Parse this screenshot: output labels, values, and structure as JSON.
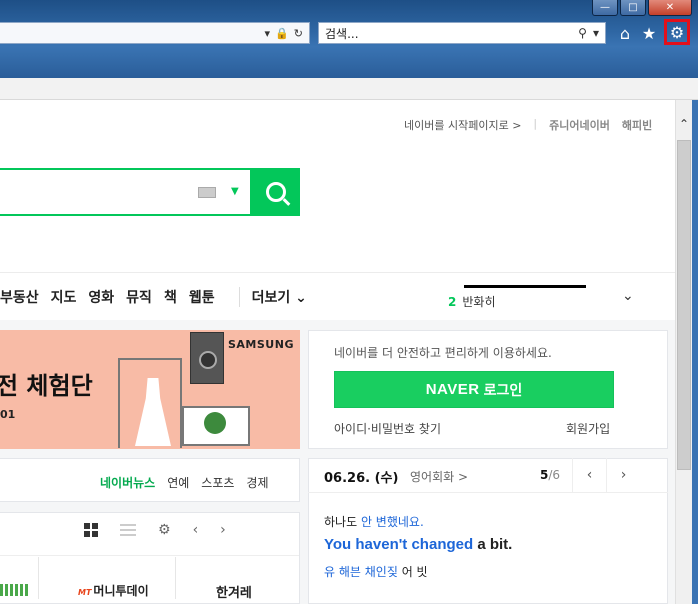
{
  "browser": {
    "search_placeholder": "검색...",
    "window_controls": {
      "minimize": "—",
      "maximize": "□",
      "close": "✕"
    },
    "icons": {
      "home": "home-icon",
      "favorites": "star-icon",
      "tools": "gear-icon",
      "lock": "lock-icon",
      "refresh": "refresh-icon",
      "search": "search-icon"
    },
    "highlight_color": "#e3101b"
  },
  "page": {
    "top_links": {
      "set_home": "네이버를 시작페이지로 >",
      "junior": "쥬니어네이버",
      "happybean": "해피빈"
    },
    "nav_menu": [
      "부동산",
      "지도",
      "영화",
      "뮤직",
      "책",
      "웹툰"
    ],
    "more_label": "더보기",
    "user_label": "반화히",
    "banner": {
      "title": "전 체험단",
      "sub": "01",
      "brand": "SAMSUNG"
    },
    "news_tabs": [
      "네이버뉴스",
      "연예",
      "스포츠",
      "경제"
    ],
    "press": [
      "머니투데이",
      "한겨레"
    ],
    "press_mt_mark": "MT",
    "login": {
      "message": "네이버를 더 안전하고 편리하게 이용하세요.",
      "button_brand": "NAVER",
      "button_text": "로그인",
      "find": "아이디·비밀번호 찾기",
      "signup": "회원가입"
    },
    "english": {
      "date": "06.26. (수)",
      "category": "영어회화 >",
      "page_current": "5",
      "page_total": "/6",
      "korean_plain": "하나도 ",
      "korean_hl": "안 변했네요.",
      "english_hl": "You haven't changed",
      "english_plain": " a bit.",
      "pron_hl": "유 해븐 채인짖",
      "pron_plain": " 어 빗"
    },
    "brand_color": "#03c75a"
  }
}
